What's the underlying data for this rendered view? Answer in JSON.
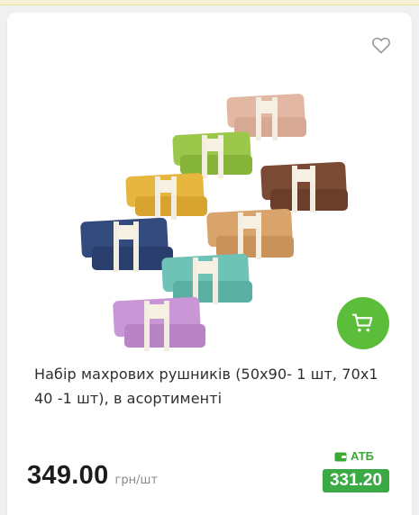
{
  "product": {
    "title": "Набір махрових рушників (50х90- 1 шт, 70х1 40 -1 шт), в асортименті",
    "price": "349.00",
    "unit": "грн/шт",
    "loyalty": {
      "label": "АТБ",
      "price": "331.20"
    }
  },
  "icons": {
    "favorite": "heart-outline-icon",
    "cart": "shopping-cart-icon",
    "loyalty": "wallet-icon"
  },
  "colors": {
    "accent_green": "#5bbd3a",
    "loyalty_green": "#3ba944",
    "towel_colors": [
      "#e2b8a5",
      "#94c145",
      "#e3b23c",
      "#7a4a34",
      "#d9a46b",
      "#324a7c",
      "#6ec2b6",
      "#c997d6"
    ]
  }
}
